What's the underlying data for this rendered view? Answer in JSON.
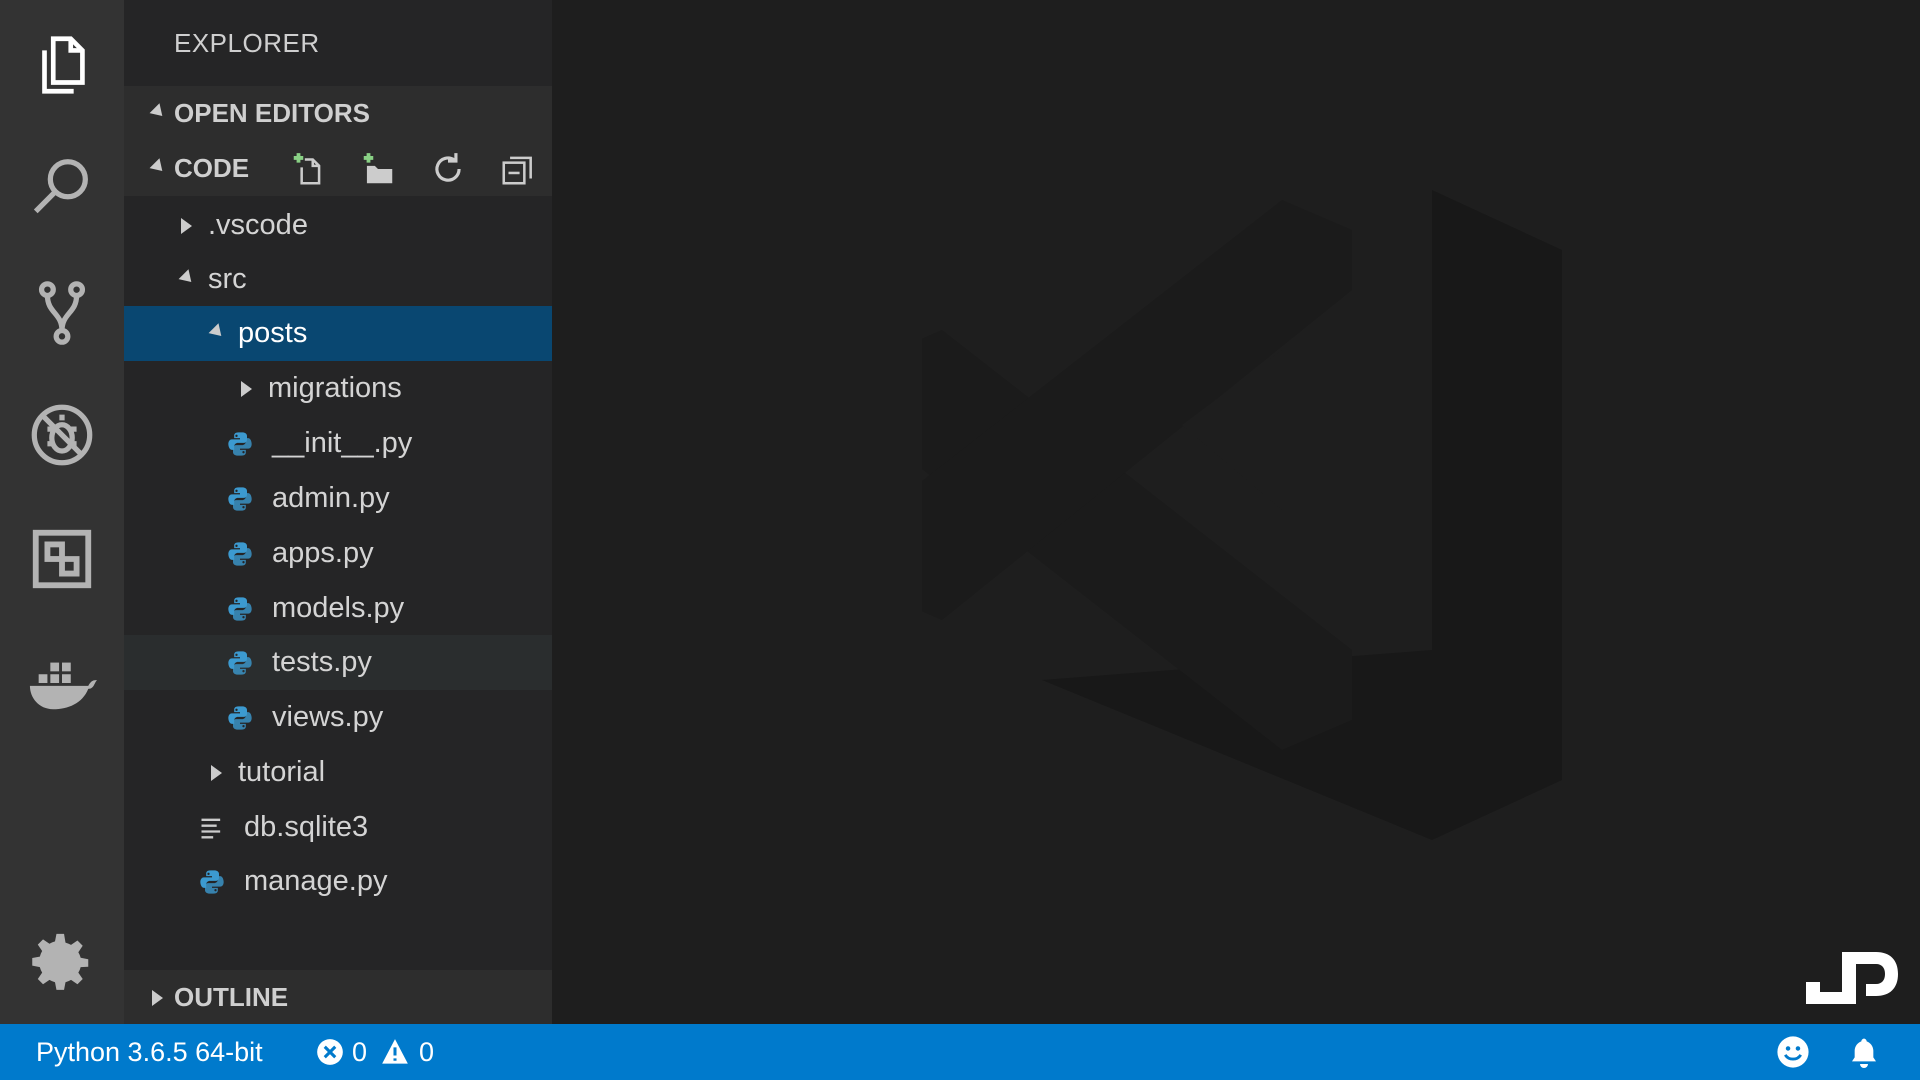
{
  "sidebar": {
    "title": "EXPLORER",
    "sections": {
      "open_editors": "OPEN EDITORS",
      "code": "CODE",
      "outline": "OUTLINE"
    }
  },
  "tree": {
    "vscode": ".vscode",
    "src": "src",
    "posts": "posts",
    "migrations": "migrations",
    "init": "__init__.py",
    "admin": "admin.py",
    "apps": "apps.py",
    "models": "models.py",
    "tests": "tests.py",
    "views": "views.py",
    "tutorial": "tutorial",
    "db": "db.sqlite3",
    "manage": "manage.py"
  },
  "status": {
    "interpreter": "Python 3.6.5 64-bit",
    "errors": "0",
    "warnings": "0"
  },
  "colors": {
    "status_bar": "#007acc",
    "selection": "#094771",
    "activity_bar": "#333333",
    "sidebar": "#252526",
    "python_icon": "#3c9ad0"
  }
}
